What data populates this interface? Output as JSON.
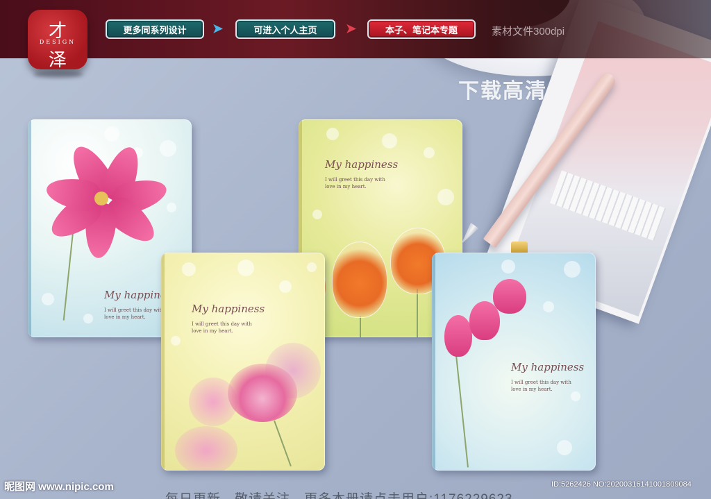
{
  "logo": {
    "char1": "才",
    "design": "DESIGN",
    "char2": "泽"
  },
  "banner": {
    "buttons": [
      {
        "label": "更多同系列设计"
      },
      {
        "label": "可进入个人主页"
      },
      {
        "label": "本子、笔记本专题"
      }
    ],
    "arrow_glyph": "➤",
    "resolution": "素材文件300dpi"
  },
  "download_label": "下载高清",
  "notebooks": [
    {
      "title": "My happiness",
      "line1": "I will greet this day with",
      "line2": "love in my heart."
    },
    {
      "title": "My happiness",
      "line1": "I will greet this day with",
      "line2": "love in my heart."
    },
    {
      "title": "My happiness",
      "line1": "I will greet this day with",
      "line2": "love in my heart."
    },
    {
      "title": "My happiness",
      "line1": "I will greet this day with",
      "line2": "love in my heart."
    }
  ],
  "footer": {
    "watermark": "昵图网 www.nipic.com",
    "id": "ID:5262426 NO:20200316141001809084",
    "note": "每日更新，敬请关注。更多本册请点击用户:1176229623"
  },
  "colors": {
    "banner": "#4a0d1a",
    "button_teal": "#1e6a6c",
    "button_red": "#e02b3a",
    "desk": "#a9b5cc"
  }
}
